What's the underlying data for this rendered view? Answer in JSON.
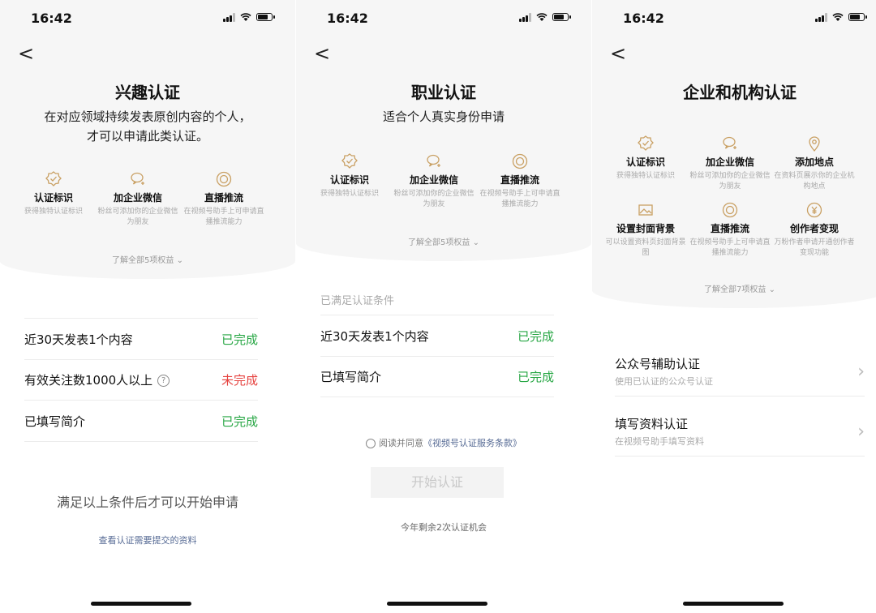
{
  "status": {
    "time": "16:42"
  },
  "back_label": "<",
  "more_chevron": "⌄",
  "option_chevron": "›",
  "help_glyph": "?",
  "screen1": {
    "title": "兴趣认证",
    "subtitle_line1": "在对应领域持续发表原创内容的个人，",
    "subtitle_line2": "才可以申请此类认证。",
    "benefits": [
      {
        "icon": "badge-check-icon",
        "title": "认证标识",
        "desc": "获得独特认证标识"
      },
      {
        "icon": "wechat-add-icon",
        "title": "加企业微信",
        "desc": "粉丝可添加你的企业微信为朋友"
      },
      {
        "icon": "live-stream-icon",
        "title": "直播推流",
        "desc": "在视频号助手上可申请直播推流能力"
      }
    ],
    "more": "了解全部5项权益",
    "conditions": [
      {
        "label": "近30天发表1个内容",
        "status": "已完成",
        "done": true
      },
      {
        "label": "有效关注数1000人以上",
        "status": "未完成",
        "done": false
      },
      {
        "label": "已填写简介",
        "status": "已完成",
        "done": true
      }
    ],
    "notice": "满足以上条件后才可以开始申请",
    "link": "查看认证需要提交的资料"
  },
  "screen2": {
    "title": "职业认证",
    "subtitle": "适合个人真实身份申请",
    "benefits": [
      {
        "icon": "badge-check-icon",
        "title": "认证标识",
        "desc": "获得独特认证标识"
      },
      {
        "icon": "wechat-add-icon",
        "title": "加企业微信",
        "desc": "粉丝可添加你的企业微信为朋友"
      },
      {
        "icon": "live-stream-icon",
        "title": "直播推流",
        "desc": "在视频号助手上可申请直播推流能力"
      }
    ],
    "more": "了解全部5项权益",
    "section_label": "已满足认证条件",
    "conditions": [
      {
        "label": "近30天发表1个内容",
        "status": "已完成",
        "done": true
      },
      {
        "label": "已填写简介",
        "status": "已完成",
        "done": true
      }
    ],
    "agree_prefix": "阅读并同意",
    "agree_link": "《视频号认证服务条款》",
    "start_button": "开始认证",
    "remaining": "今年剩余2次认证机会"
  },
  "screen3": {
    "title": "企业和机构认证",
    "benefits": [
      {
        "icon": "badge-check-icon",
        "title": "认证标识",
        "desc": "获得独特认证标识"
      },
      {
        "icon": "wechat-add-icon",
        "title": "加企业微信",
        "desc": "粉丝可添加你的企业微信为朋友"
      },
      {
        "icon": "location-pin-icon",
        "title": "添加地点",
        "desc": "在资料页展示你的企业机构地点"
      },
      {
        "icon": "image-icon",
        "title": "设置封面背景",
        "desc": "可以设置资料页封面背景图"
      },
      {
        "icon": "live-stream-icon",
        "title": "直播推流",
        "desc": "在视频号助手上可申请直播推流能力"
      },
      {
        "icon": "yen-coin-icon",
        "title": "创作者变现",
        "desc": "万粉作者申请开通创作者变现功能"
      }
    ],
    "more": "了解全部7项权益",
    "options": [
      {
        "title": "公众号辅助认证",
        "subtitle": "使用已认证的公众号认证"
      },
      {
        "title": "填写资料认证",
        "subtitle": "在视频号助手填写资料"
      }
    ]
  },
  "colors": {
    "accent_icon": "#c9a063",
    "done_green": "#28a745",
    "undone_red": "#e64340",
    "link_blue": "#576b95"
  }
}
